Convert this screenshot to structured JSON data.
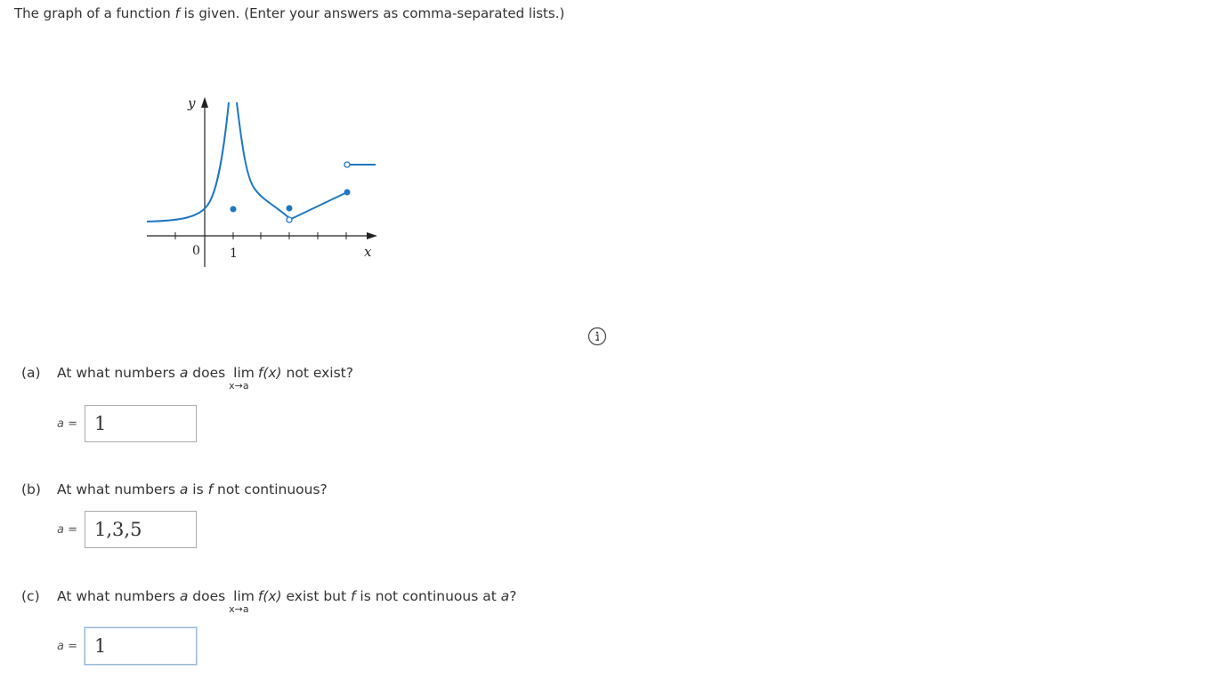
{
  "intro": {
    "text_before": "The graph of a function ",
    "fn": "f",
    "text_after": " is given. (Enter your answers as comma-separated lists.)"
  },
  "graph": {
    "y_label": "y",
    "x_label": "x",
    "origin_label": "0",
    "tick_label": "1"
  },
  "info_icon": "info-icon",
  "part_a": {
    "label": "(a)",
    "t1": "At what numbers ",
    "var_a": "a",
    "t2": " does ",
    "lim": "lim",
    "sub": "x→a",
    "fx": "f(x)",
    "t3": " not exist?",
    "answer_label": "a",
    "equals": "=",
    "answer": "1"
  },
  "part_b": {
    "label": "(b)",
    "t1": "At what numbers ",
    "var_a": "a",
    "t2": " is ",
    "fn": "f",
    "t3": " not continuous?",
    "answer_label": "a",
    "equals": "=",
    "answer": "1,3,5"
  },
  "part_c": {
    "label": "(c)",
    "t1": "At what numbers ",
    "var_a": "a",
    "t2": " does ",
    "lim": "lim",
    "sub": "x→a",
    "fx": "f(x)",
    "t3": " exist but ",
    "fn": "f",
    "t4": " is not continuous at ",
    "var_a2": "a",
    "t5": "?",
    "answer_label": "a",
    "equals": "=",
    "answer": "1"
  }
}
